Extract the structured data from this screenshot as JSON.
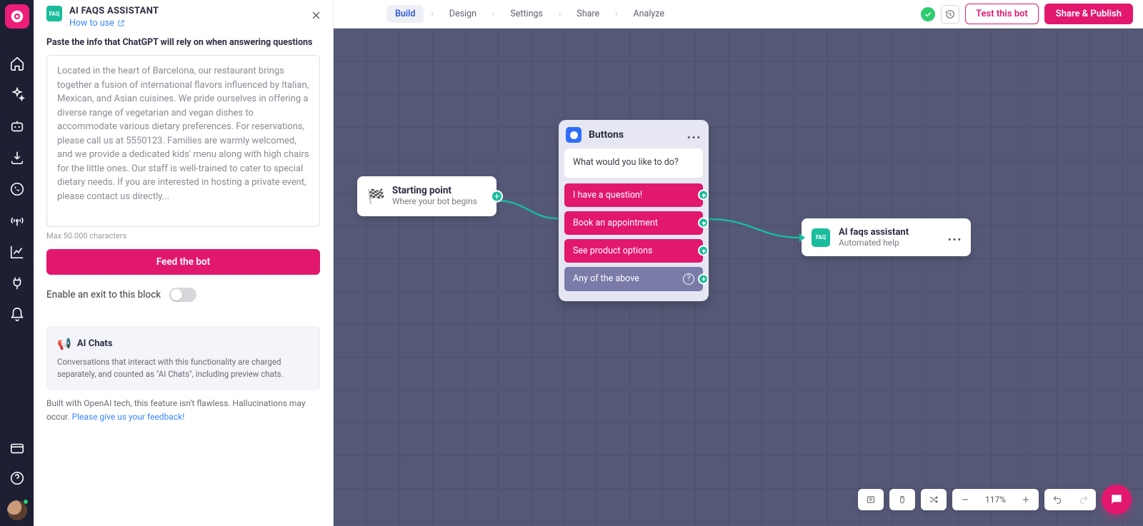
{
  "panel": {
    "badge": "FAQ",
    "title": "AI FAQS ASSISTANT",
    "howto": "How to use",
    "field_label": "Paste the info that ChatGPT will rely on when answering questions",
    "textarea": "Located in the heart of Barcelona, our restaurant brings together a fusion of international flavors influenced by Italian, Mexican, and Asian cuisines. We pride ourselves in offering a diverse range of vegetarian and vegan dishes to accommodate various dietary preferences. For reservations, please call us at 5550123. Families are warmly welcomed, and we provide a dedicated kids' menu along with high chairs for the little ones. Our staff is well-trained to cater to special dietary needs. If you are interested in hosting a private event, please contact us directly...",
    "max_hint": "Max 50.000 characters",
    "feed_btn": "Feed the bot",
    "exit_label": "Enable an exit to this block",
    "info_title": "AI Chats",
    "info_body": "Conversations that interact with this functionality are charged separately, and counted as \"AI Chats\", including preview chats.",
    "footer_note": "Built with OpenAI tech, this feature isn't flawless. Hallucinations may occur. ",
    "feedback_link": "Please give us your feedback!"
  },
  "topbar": {
    "tabs": [
      "Build",
      "Design",
      "Settings",
      "Share",
      "Analyze"
    ],
    "test": "Test this bot",
    "share": "Share & Publish"
  },
  "canvas": {
    "start": {
      "title": "Starting point",
      "sub": "Where your bot begins"
    },
    "buttons": {
      "title": "Buttons",
      "question": "What would you like to do?",
      "options": [
        "I have a question!",
        "Book an appointment",
        "See product options",
        "Any of the above"
      ]
    },
    "faq": {
      "title": "AI faqs assistant",
      "sub": "Automated help"
    }
  },
  "zoom": "117%"
}
